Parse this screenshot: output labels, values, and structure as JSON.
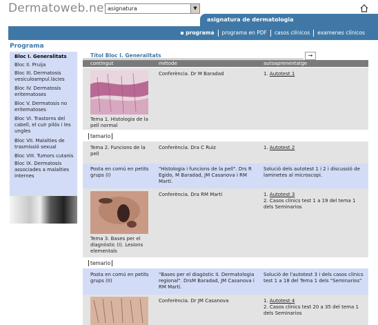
{
  "header": {
    "logo": "Dermatoweb.net",
    "select_value": "asignatura",
    "tab_title": "asignatura de dermatologia"
  },
  "nav": [
    {
      "label": "programa",
      "active": true
    },
    {
      "label": "programa en PDF",
      "active": false
    },
    {
      "label": "casos clínicos",
      "active": false
    },
    {
      "label": "examenes clínicos",
      "active": false
    }
  ],
  "section_title": "Programa",
  "sidebar": [
    "Bloc I. Generalitats",
    "Bloc II. Pruija",
    "Bloc III. Dermatosis vesiculoampul.lácies",
    "Bloc IV. Dermatosis eritematoses",
    "Bloc V. Dermatosis no eritematoses",
    "Bloc VI. Trastorns del cabell, el cuir pilós i les ungles",
    "Bloc VII. Malalties de trasmissió sexual",
    "Bloc VIII. Tumors cutanis",
    "Bloc IX. Dermatosis associades a malalties internes"
  ],
  "main": {
    "title": "Títol Bloc I. Generalitats",
    "columns": [
      "contingut",
      "métode",
      "autoaprenentatge"
    ],
    "temario_label": "temario",
    "rows": [
      {
        "content": "Tema 1. Histologia de la pell normal",
        "method": "Conferència. Dr M Baradad",
        "auto1": "Autotest 1",
        "auto2": ""
      },
      {
        "content": "Tema 2. Funcions de la pell",
        "method": "Conferència. Dra C Ruiz",
        "auto1": "Autotest 2",
        "auto2": ""
      },
      {
        "content": "Posta en comú en petits grups (I)",
        "method": "\"Histologia i funcions de la pell\". Drs R Egido, M Baradad, JM Casanova i RM Martí.",
        "auto1": "Solució dels autotest 1 i 2 i discussió de laminetes al microscopi.",
        "auto2": ""
      },
      {
        "content": "Tema 3. Bases per el diagnòstic (I). Lesions elementals",
        "method": "Conferència. Dra RM Martí",
        "auto1": "Autotest 3",
        "auto2": "2. Casos clínics test 1 a 19 del tema 1 dels Seminarios"
      },
      {
        "content": "Posta en comú en petits grups (II)",
        "method": "\"Bases per el diagòstic II. Dermatologia regional\". DrsM Baradad, JM Casanova i RM Martí.",
        "auto1": "Solució de l'autotest 3 i dels casos clínics test 1 a 18 del Tema 1 dels \"Seminarios\"",
        "auto2": ""
      },
      {
        "content": "",
        "method": "Conferència. Dr JM Casanova",
        "auto1": "Autotest 4",
        "auto2": "2. Casos clínics test 20 a 35 del tema 1 dels Seminarios"
      }
    ]
  }
}
